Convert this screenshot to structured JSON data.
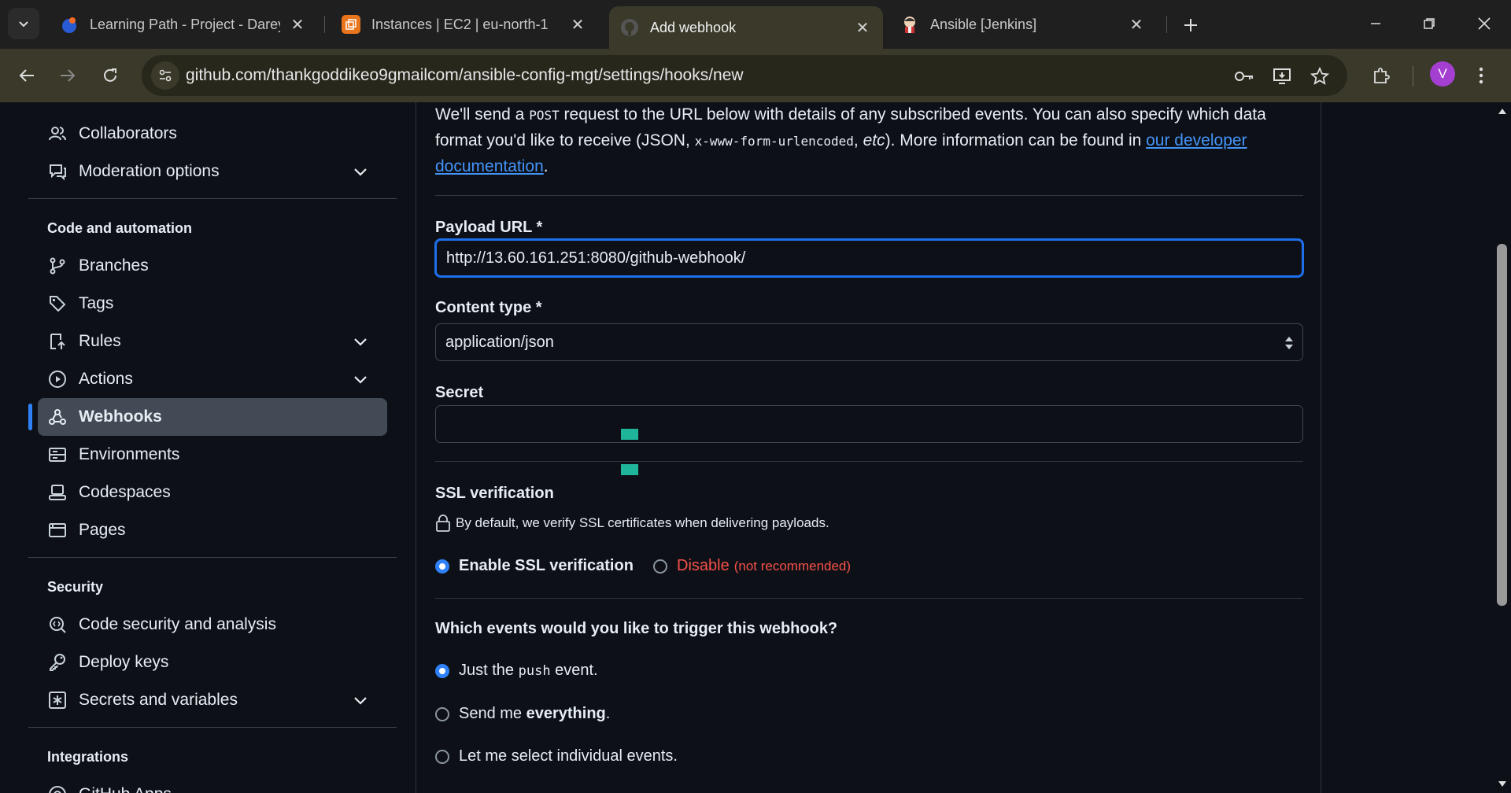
{
  "browser": {
    "tabs": [
      {
        "title": "Learning Path - Project - Darey.",
        "favicon": "darey-icon"
      },
      {
        "title": "Instances | EC2 | eu-north-1",
        "favicon": "aws-icon"
      },
      {
        "title": "Add webhook",
        "favicon": "github-icon",
        "active": true
      },
      {
        "title": "Ansible [Jenkins]",
        "favicon": "jenkins-icon"
      }
    ],
    "url": "github.com/thankgoddikeo9gmailcom/ansible-config-mgt/settings/hooks/new",
    "profile_initial": "V"
  },
  "sidebar": {
    "top_items": [
      {
        "label": "Collaborators",
        "icon": "people-icon"
      },
      {
        "label": "Moderation options",
        "icon": "comment-icon",
        "expandable": true
      }
    ],
    "code_section_title": "Code and automation",
    "code_items": [
      {
        "label": "Branches",
        "icon": "branch-icon"
      },
      {
        "label": "Tags",
        "icon": "tag-icon"
      },
      {
        "label": "Rules",
        "icon": "rules-icon",
        "expandable": true
      },
      {
        "label": "Actions",
        "icon": "play-icon",
        "expandable": true
      },
      {
        "label": "Webhooks",
        "icon": "webhook-icon",
        "active": true
      },
      {
        "label": "Environments",
        "icon": "server-icon"
      },
      {
        "label": "Codespaces",
        "icon": "codespaces-icon"
      },
      {
        "label": "Pages",
        "icon": "browser-icon"
      }
    ],
    "security_section_title": "Security",
    "security_items": [
      {
        "label": "Code security and analysis",
        "icon": "codescan-icon"
      },
      {
        "label": "Deploy keys",
        "icon": "key-icon"
      },
      {
        "label": "Secrets and variables",
        "icon": "asterisk-icon",
        "expandable": true
      }
    ],
    "integrations_section_title": "Integrations",
    "integrations_items": [
      {
        "label": "GitHub Apps",
        "icon": "apps-icon"
      }
    ]
  },
  "form": {
    "intro_part1": "We'll send a ",
    "intro_code1": "POST",
    "intro_part2": " request to the URL below with details of any subscribed events. You can also specify which data format you'd like to receive (JSON, ",
    "intro_code2": "x-www-form-urlencoded",
    "intro_part3": ", ",
    "intro_etc": "etc",
    "intro_part4": "). More information can be found in ",
    "intro_link": "our developer documentation",
    "intro_part5": ".",
    "payload_url_label": "Payload URL *",
    "payload_url_value": "http://13.60.161.251:8080/github-webhook/",
    "content_type_label": "Content type *",
    "content_type_value": "application/json",
    "secret_label": "Secret",
    "secret_value": "",
    "ssl_title": "SSL verification",
    "ssl_note": "By default, we verify SSL certificates when delivering payloads.",
    "ssl_enable_label": "Enable SSL verification",
    "ssl_disable_label": "Disable",
    "ssl_disable_note": "(not recommended)",
    "events_question": "Which events would you like to trigger this webhook?",
    "event_push_part1": "Just the ",
    "event_push_code": "push",
    "event_push_part2": " event.",
    "event_everything_part1": "Send me ",
    "event_everything_bold": "everything",
    "event_everything_part2": ".",
    "event_individual": "Let me select individual events."
  },
  "colors": {
    "accent": "#2f81f7",
    "link": "#4493f8",
    "danger": "#f85149",
    "background": "#0d1117",
    "chrome_toolbar": "#3b3a2a"
  }
}
